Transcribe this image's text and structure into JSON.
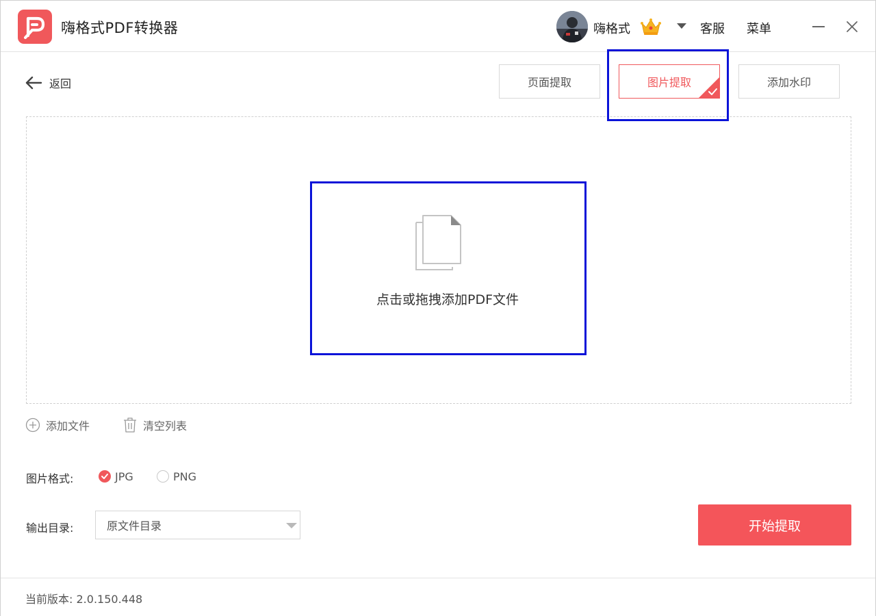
{
  "app": {
    "title": "嗨格式PDF转换器",
    "logo_icon": "pdf-logo-icon",
    "brand_color": "#f0585b"
  },
  "header": {
    "user_name": "嗨格式",
    "vip_icon": "crown-icon",
    "service_label": "客服",
    "menu_label": "菜单"
  },
  "toolbar": {
    "back_label": "返回",
    "tabs": [
      {
        "label": "页面提取",
        "active": false
      },
      {
        "label": "图片提取",
        "active": true
      },
      {
        "label": "添加水印",
        "active": false
      }
    ]
  },
  "dropzone": {
    "icon": "document-icon",
    "text": "点击或拖拽添加PDF文件"
  },
  "file_actions": {
    "add_label": "添加文件",
    "clear_label": "清空列表"
  },
  "image_format": {
    "label": "图片格式:",
    "options": [
      {
        "label": "JPG",
        "checked": true
      },
      {
        "label": "PNG",
        "checked": false
      }
    ]
  },
  "output": {
    "label": "输出目录:",
    "selected": "原文件目录"
  },
  "start_button": {
    "label": "开始提取",
    "color": "#f4555a"
  },
  "footer": {
    "version_label": "当前版本:",
    "version_value": "2.0.150.448"
  }
}
